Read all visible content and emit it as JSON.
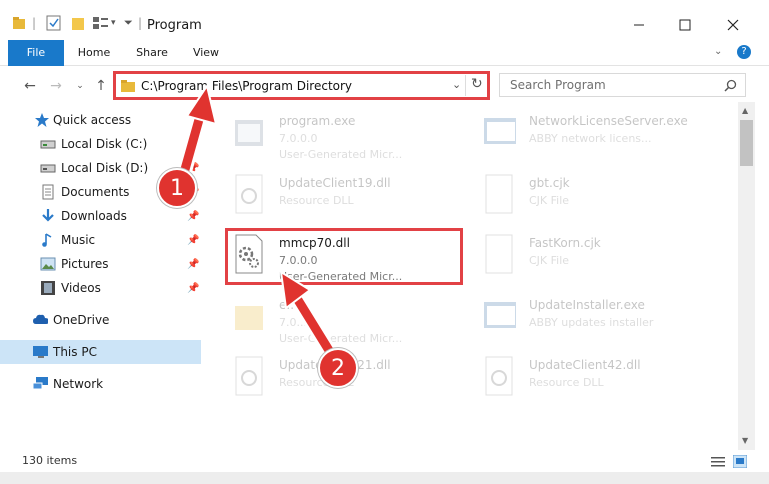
{
  "window": {
    "title": "Program"
  },
  "ribbon": {
    "tabs": [
      "File",
      "Home",
      "Share",
      "View"
    ]
  },
  "address": {
    "path": "C:\\Program Files\\Program Directory"
  },
  "search": {
    "placeholder": "Search Program"
  },
  "sidebar": {
    "items": [
      {
        "label": "Quick access",
        "icon": "star-icon"
      },
      {
        "label": "Local Disk (C:)",
        "icon": "drive-icon"
      },
      {
        "label": "Local Disk (D:)",
        "icon": "drive-icon"
      },
      {
        "label": "Documents",
        "icon": "documents-icon"
      },
      {
        "label": "Downloads",
        "icon": "download-icon"
      },
      {
        "label": "Music",
        "icon": "music-icon"
      },
      {
        "label": "Pictures",
        "icon": "pictures-icon"
      },
      {
        "label": "Videos",
        "icon": "videos-icon"
      },
      {
        "label": "OneDrive",
        "icon": "cloud-icon"
      },
      {
        "label": "This PC",
        "icon": "computer-icon"
      },
      {
        "label": "Network",
        "icon": "network-icon"
      }
    ]
  },
  "files": [
    {
      "name": "program.exe",
      "line1": "7.0.0.0",
      "line2": "User-Generated Micr..."
    },
    {
      "name": "NetworkLicenseServer.exe",
      "line1": "ABBY network licens...",
      "line2": ""
    },
    {
      "name": "UpdateClient19.dll",
      "line1": "Resource DLL",
      "line2": ""
    },
    {
      "name": "gbt.cjk",
      "line1": "CJK File",
      "line2": ""
    },
    {
      "name": "mmcp70.dll",
      "line1": "7.0.0.0",
      "line2": "User-Generated Micr..."
    },
    {
      "name": "FastKorn.cjk",
      "line1": "CJK File",
      "line2": ""
    },
    {
      "name": "e...",
      "line1": "7.0...",
      "line2": "User-Generated Micr..."
    },
    {
      "name": "UpdateInstaller.exe",
      "line1": "ABBY updates installer",
      "line2": ""
    },
    {
      "name": "UpdateClient21.dll",
      "line1": "Resource DLL",
      "line2": ""
    },
    {
      "name": "UpdateClient42.dll",
      "line1": "Resource DLL",
      "line2": ""
    }
  ],
  "annotations": {
    "badge1": "1",
    "badge2": "2"
  },
  "status": {
    "items_count": "130 items"
  },
  "colors": {
    "accent": "#1979ca",
    "highlight": "#e24145",
    "badge": "#e0332f"
  }
}
